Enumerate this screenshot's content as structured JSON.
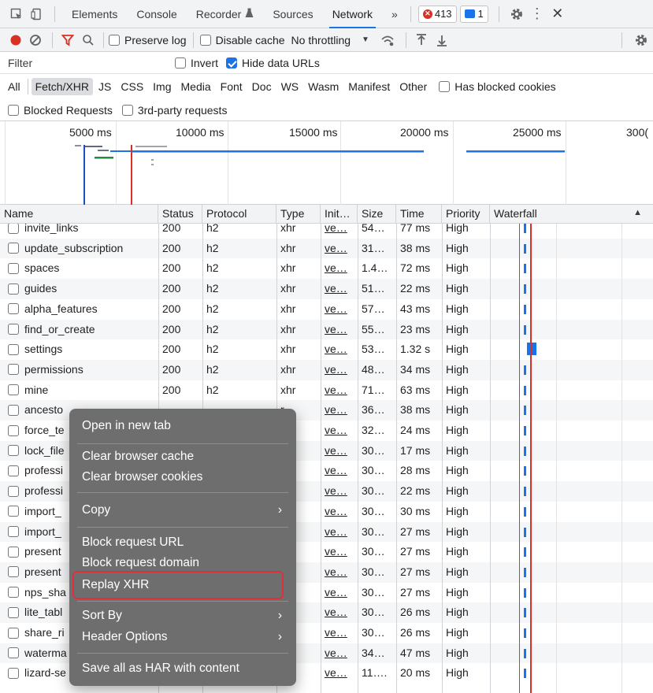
{
  "tabs": {
    "items": [
      "Elements",
      "Console",
      "Recorder",
      "Sources",
      "Network"
    ],
    "active": "Network",
    "more": "»",
    "errors_count": "413",
    "messages_count": "1"
  },
  "toolbar": {
    "preserve_log": "Preserve log",
    "disable_cache": "Disable cache",
    "throttling": "No throttling"
  },
  "filter": {
    "placeholder": "Filter",
    "invert": "Invert",
    "hide_data_urls": "Hide data URLs"
  },
  "types": [
    "All",
    "Fetch/XHR",
    "JS",
    "CSS",
    "Img",
    "Media",
    "Font",
    "Doc",
    "WS",
    "Wasm",
    "Manifest",
    "Other"
  ],
  "active_type": "Fetch/XHR",
  "has_blocked_cookies": "Has blocked cookies",
  "blocked_requests": "Blocked Requests",
  "third_party": "3rd-party requests",
  "timeline": {
    "ticks": [
      "5000 ms",
      "10000 ms",
      "15000 ms",
      "20000 ms",
      "25000 ms",
      "300("
    ]
  },
  "columns": [
    "Name",
    "Status",
    "Protocol",
    "Type",
    "Init…",
    "Size",
    "Time",
    "Priority",
    "Waterfall"
  ],
  "rows": [
    {
      "name": "invite_links",
      "status": "200",
      "protocol": "h2",
      "type": "xhr",
      "init": "ve…",
      "size": "54…",
      "time": "77 ms",
      "priority": "High"
    },
    {
      "name": "update_subscription",
      "status": "200",
      "protocol": "h2",
      "type": "xhr",
      "init": "ve…",
      "size": "31…",
      "time": "38 ms",
      "priority": "High"
    },
    {
      "name": "spaces",
      "status": "200",
      "protocol": "h2",
      "type": "xhr",
      "init": "ve…",
      "size": "1.4…",
      "time": "72 ms",
      "priority": "High"
    },
    {
      "name": "guides",
      "status": "200",
      "protocol": "h2",
      "type": "xhr",
      "init": "ve…",
      "size": "51…",
      "time": "22 ms",
      "priority": "High"
    },
    {
      "name": "alpha_features",
      "status": "200",
      "protocol": "h2",
      "type": "xhr",
      "init": "ve…",
      "size": "57…",
      "time": "43 ms",
      "priority": "High"
    },
    {
      "name": "find_or_create",
      "status": "200",
      "protocol": "h2",
      "type": "xhr",
      "init": "ve…",
      "size": "55…",
      "time": "23 ms",
      "priority": "High"
    },
    {
      "name": "settings",
      "status": "200",
      "protocol": "h2",
      "type": "xhr",
      "init": "ve…",
      "size": "53…",
      "time": "1.32 s",
      "priority": "High"
    },
    {
      "name": "permissions",
      "status": "200",
      "protocol": "h2",
      "type": "xhr",
      "init": "ve…",
      "size": "48…",
      "time": "34 ms",
      "priority": "High"
    },
    {
      "name": "mine",
      "status": "200",
      "protocol": "h2",
      "type": "xhr",
      "init": "ve…",
      "size": "71…",
      "time": "63 ms",
      "priority": "High"
    },
    {
      "name": "ancesto",
      "status": "",
      "protocol": "",
      "type": "r",
      "init": "ve…",
      "size": "36…",
      "time": "38 ms",
      "priority": "High"
    },
    {
      "name": "force_te",
      "status": "",
      "protocol": "",
      "type": "r",
      "init": "ve…",
      "size": "32…",
      "time": "24 ms",
      "priority": "High"
    },
    {
      "name": "lock_file",
      "status": "",
      "protocol": "",
      "type": "r",
      "init": "ve…",
      "size": "30…",
      "time": "17 ms",
      "priority": "High"
    },
    {
      "name": "professi",
      "status": "",
      "protocol": "",
      "type": "r",
      "init": "ve…",
      "size": "30…",
      "time": "28 ms",
      "priority": "High"
    },
    {
      "name": "professi",
      "status": "",
      "protocol": "",
      "type": "r",
      "init": "ve…",
      "size": "30…",
      "time": "22 ms",
      "priority": "High"
    },
    {
      "name": "import_",
      "status": "",
      "protocol": "",
      "type": "r",
      "init": "ve…",
      "size": "30…",
      "time": "30 ms",
      "priority": "High"
    },
    {
      "name": "import_",
      "status": "",
      "protocol": "",
      "type": "r",
      "init": "ve…",
      "size": "30…",
      "time": "27 ms",
      "priority": "High"
    },
    {
      "name": "present",
      "status": "",
      "protocol": "",
      "type": "r",
      "init": "ve…",
      "size": "30…",
      "time": "27 ms",
      "priority": "High"
    },
    {
      "name": "present",
      "status": "",
      "protocol": "",
      "type": "r",
      "init": "ve…",
      "size": "30…",
      "time": "27 ms",
      "priority": "High"
    },
    {
      "name": "nps_sha",
      "status": "",
      "protocol": "",
      "type": "r",
      "init": "ve…",
      "size": "30…",
      "time": "27 ms",
      "priority": "High"
    },
    {
      "name": "lite_tabl",
      "status": "",
      "protocol": "",
      "type": "r",
      "init": "ve…",
      "size": "30…",
      "time": "26 ms",
      "priority": "High"
    },
    {
      "name": "share_ri",
      "status": "",
      "protocol": "",
      "type": "r",
      "init": "ve…",
      "size": "30…",
      "time": "26 ms",
      "priority": "High"
    },
    {
      "name": "waterma",
      "status": "",
      "protocol": "",
      "type": "r",
      "init": "ve…",
      "size": "34…",
      "time": "47 ms",
      "priority": "High"
    },
    {
      "name": "lizard-se",
      "status": "",
      "protocol": "",
      "type": "r",
      "init": "ve…",
      "size": "11….",
      "time": "20 ms",
      "priority": "High"
    }
  ],
  "context_menu": {
    "open_new_tab": "Open in new tab",
    "clear_cache": "Clear browser cache",
    "clear_cookies": "Clear browser cookies",
    "copy": "Copy",
    "block_url": "Block request URL",
    "block_domain": "Block request domain",
    "replay_xhr": "Replay XHR",
    "sort_by": "Sort By",
    "header_options": "Header Options",
    "save_har": "Save all as HAR with content",
    "submenu_arrow": "›"
  },
  "colors": {
    "accent": "#1a73e8",
    "error": "#d93025",
    "highlight": "#e02e3d",
    "menu_bg": "#6e6e6e"
  }
}
